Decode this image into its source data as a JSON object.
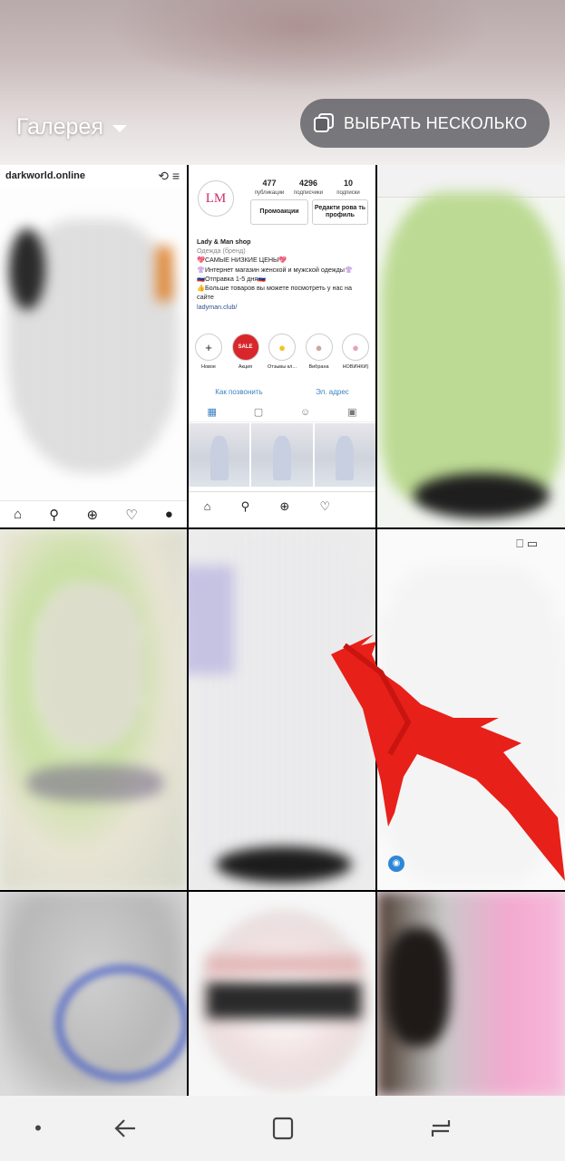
{
  "header": {
    "title": "Галерея",
    "multi_select_label": "ВЫБРАТЬ НЕСКОЛЬКО"
  },
  "grid": {
    "cell1": {
      "site": "darkworld.online",
      "icons": "⟲ ≡"
    },
    "cell2": {
      "avatar_text": "LM",
      "stats": [
        {
          "value": "477",
          "label": "публикации"
        },
        {
          "value": "4296",
          "label": "подписчики"
        },
        {
          "value": "10",
          "label": "подписки"
        }
      ],
      "buttons": {
        "promo": "Промоакции",
        "edit": "Редакти рова ть профиль"
      },
      "bio": {
        "name": "Lady & Man shop",
        "category": "Одежда (бренд)",
        "line1": "💖САМЫЕ НИЗКИЕ ЦЕНЫ💖",
        "line2": "👚Интернет магазин женской и мужской одежды👚",
        "line3": "🇷🇺Отправка 1-5 дня🇷🇺",
        "line4": "👍Больше товаров вы можете посмотреть у нас на сайте",
        "link": "ladyman.club/"
      },
      "highlights": [
        {
          "label": "Новое",
          "icon": "+"
        },
        {
          "label": "Акция",
          "icon": "SALE"
        },
        {
          "label": "Отзывы кл...",
          "icon": "●"
        },
        {
          "label": "Вибрана",
          "icon": "●"
        },
        {
          "label": "НОВИНКИ)",
          "icon": "●"
        }
      ],
      "contact": {
        "call": "Как позвонить",
        "email": "Эл. адрес"
      }
    }
  },
  "navbar": {
    "dot": "•"
  },
  "colors": {
    "arrow": "#e8201a",
    "link_blue": "#3b82c4",
    "button_bg": "#5f5f64"
  }
}
